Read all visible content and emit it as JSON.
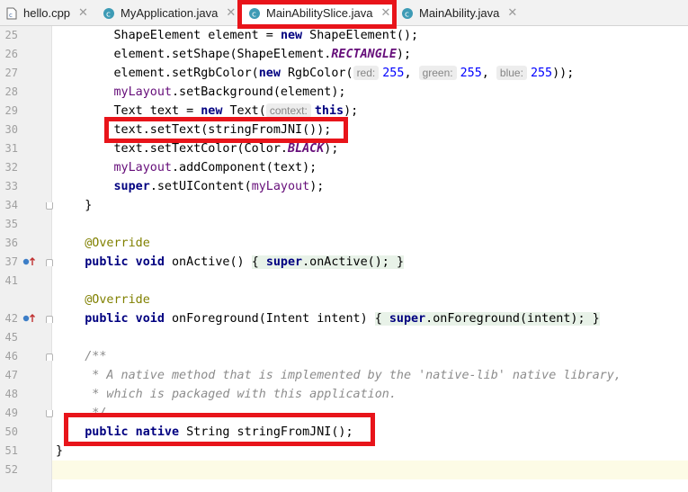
{
  "tabs": [
    {
      "label": "hello.cpp",
      "icon": "cpp-file-icon",
      "active": false
    },
    {
      "label": "MyApplication.java",
      "icon": "java-class-icon",
      "active": false
    },
    {
      "label": "MainAbilitySlice.java",
      "icon": "java-class-icon",
      "active": true
    },
    {
      "label": "MainAbility.java",
      "icon": "java-class-icon",
      "active": false
    }
  ],
  "tab_close_glyph": "✕",
  "line_numbers": [
    "25",
    "26",
    "27",
    "28",
    "29",
    "30",
    "31",
    "32",
    "33",
    "34",
    "35",
    "36",
    "37",
    "41",
    "42",
    "45",
    "46",
    "47",
    "48",
    "49",
    "50",
    "51",
    "52"
  ],
  "code": {
    "l25": {
      "a": "ShapeElement element = ",
      "kw": "new",
      "b": " ShapeElement();"
    },
    "l26": {
      "a": "element.setShape(ShapeElement.",
      "const": "RECTANGLE",
      "b": ");"
    },
    "l27": {
      "a": "element.setRgbColor(",
      "kw": "new",
      "b": " RgbColor(",
      "h1": "red:",
      "v1": "255",
      "s1": ", ",
      "h2": "green:",
      "v2": "255",
      "s2": ", ",
      "h3": "blue:",
      "v3": "255",
      "c": "));"
    },
    "l28": {
      "field": "myLayout",
      "a": ".setBackground(element);"
    },
    "l29": {
      "a": "Text text = ",
      "kw": "new",
      "b": " Text(",
      "hint": "context:",
      "kw2": "this",
      "c": ");"
    },
    "l30": {
      "a": "text.setText(stringFromJNI());"
    },
    "l31": {
      "a": "text.setTextColor(Color.",
      "const": "BLACK",
      "b": ");"
    },
    "l32": {
      "field": "myLayout",
      "a": ".addComponent(text);"
    },
    "l33": {
      "kw": "super",
      "a": ".setUIContent(",
      "field": "myLayout",
      "b": ");"
    },
    "l34": {
      "a": "}"
    },
    "l36": {
      "ann": "@Override"
    },
    "l37": {
      "kw": "public void",
      "a": " onActive() ",
      "body_open": "{ ",
      "kw2": "super",
      "body": ".onActive(); ",
      "body_close": "}"
    },
    "l41": {
      "ann": "@Override"
    },
    "l42": {
      "kw": "public void",
      "a": " onForeground(Intent intent) ",
      "body_open": "{ ",
      "kw2": "super",
      "body": ".onForeground(intent); ",
      "body_close": "}"
    },
    "l46": {
      "cmt": "/**"
    },
    "l47": {
      "cmt": " * A native method that is implemented by the 'native-lib' native library,"
    },
    "l48": {
      "cmt": " * which is packaged with this application."
    },
    "l49": {
      "cmt": " */"
    },
    "l50": {
      "kw": "public native",
      "a": " String stringFromJNI();"
    },
    "l51": {
      "a": "}"
    }
  },
  "colors": {
    "highlight_box": "#e8141a",
    "keyword": "#000080",
    "field": "#660e7a",
    "annotation": "#808000",
    "number": "#0000ff",
    "comment": "#8c8c8c"
  }
}
